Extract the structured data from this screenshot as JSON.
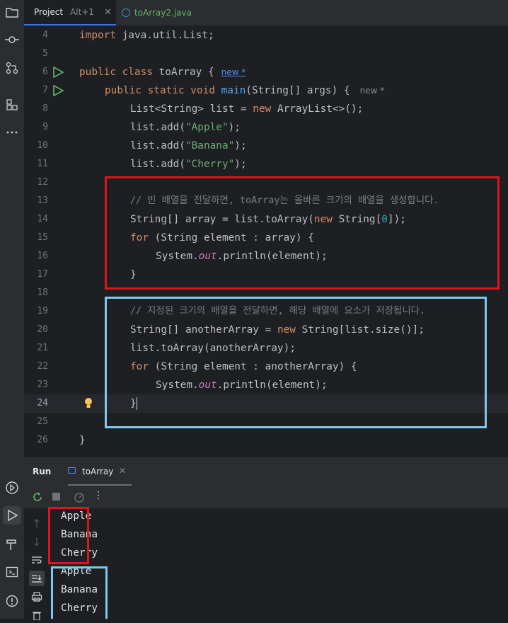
{
  "tabs": [
    {
      "label": "Project",
      "shortcut": "Alt+1"
    },
    {
      "label": "toArray2.java"
    }
  ],
  "editor": {
    "line_numbers": [
      "4",
      "5",
      "6",
      "7",
      "8",
      "9",
      "10",
      "11",
      "12",
      "13",
      "14",
      "15",
      "16",
      "17",
      "18",
      "19",
      "20",
      "21",
      "22",
      "23",
      "24",
      "25",
      "26"
    ],
    "current_line": "24",
    "hints": {
      "class_hint": "new *",
      "method_hint": "new *"
    },
    "code": {
      "l4_kw": "import",
      "l4_rest": " java.util.List;",
      "l6_kw": "public class",
      "l6_rest": " toArray {",
      "l7_kw": "public static void",
      "l7_fn": " main",
      "l7_rest": "(String[] args) {",
      "l8_a": "List<String> list = ",
      "l8_kw": "new",
      "l8_b": " ArrayList<>();",
      "l9_a": "list.add(",
      "l9_s": "\"Apple\"",
      "l9_b": ");",
      "l10_a": "list.add(",
      "l10_s": "\"Banana\"",
      "l10_b": ");",
      "l11_a": "list.add(",
      "l11_s": "\"Cherry\"",
      "l11_b": ");",
      "l13_cmt": "// 빈 배열을 전달하면, toArray는 올바른 크기의 배열을 생성합니다.",
      "l14_a": "String[] array = list.toArray(",
      "l14_kw": "new",
      "l14_b": " String[",
      "l14_n": "0",
      "l14_c": "]);",
      "l15_kw": "for",
      "l15_rest": " (String element : array) {",
      "l16_a": "System.",
      "l16_f": "out",
      "l16_b": ".println(element);",
      "l17": "}",
      "l19_cmt": "// 지정된 크기의 배열을 전달하면, 해당 배열에 요소가 저장됩니다.",
      "l20_a": "String[] anotherArray = ",
      "l20_kw": "new",
      "l20_b": " String[list.size()];",
      "l21": "list.toArray(anotherArray);",
      "l22_kw": "for",
      "l22_rest": " (String element : anotherArray) {",
      "l23_a": "System.",
      "l23_f": "out",
      "l23_b": ".println(element);",
      "l24": "}",
      "l26": "}"
    }
  },
  "run_panel": {
    "title": "Run",
    "tab_label": "toArray",
    "output_first": [
      "Apple",
      "Banana",
      "Cherry"
    ],
    "output_second": [
      "Apple",
      "Banana",
      "Cherry"
    ]
  },
  "colors": {
    "red_highlight": "#e0141b",
    "blue_highlight": "#7ec8ee",
    "accent": "#3574f0"
  }
}
